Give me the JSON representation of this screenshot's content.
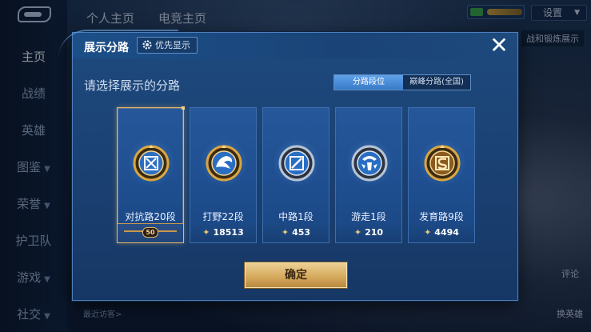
{
  "background": {
    "top_tabs": [
      "个人主页",
      "电竞主页"
    ],
    "settings_label": "设置",
    "right_hint": "战和锻炼展示",
    "left_nav": [
      {
        "label": "主页",
        "active": true
      },
      {
        "label": "战绩",
        "active": false
      },
      {
        "label": "英雄",
        "active": false
      },
      {
        "label": "图鉴",
        "active": false,
        "expandable": true
      },
      {
        "label": "荣誉",
        "active": false,
        "expandable": true
      },
      {
        "label": "护卫队",
        "active": false
      },
      {
        "label": "游戏",
        "active": false,
        "expandable": true
      },
      {
        "label": "社交",
        "active": false,
        "expandable": true
      }
    ],
    "bottom_left_text": "最近访客>",
    "bottom_right_text_1": "评论",
    "bottom_right_text_2": "换英雄"
  },
  "modal": {
    "title": "展示分路",
    "priority_label": "优先显示",
    "close_icon": "close-icon",
    "subtitle": "请选择展示的分路",
    "tabs": [
      {
        "label": "分路段位",
        "active": true
      },
      {
        "label": "巅峰分路(全国)",
        "active": false
      }
    ],
    "cards": [
      {
        "label": "对抗路20段",
        "value": "50",
        "selected": true,
        "emblem": "clash-lane-emblem-icon",
        "emblem_color": "#d9a641"
      },
      {
        "label": "打野22段",
        "value": "18513",
        "selected": false,
        "emblem": "jungle-emblem-icon",
        "emblem_color": "#d9a641"
      },
      {
        "label": "中路1段",
        "value": "453",
        "selected": false,
        "emblem": "mid-lane-emblem-icon",
        "emblem_color": "#b7c4d4"
      },
      {
        "label": "游走1段",
        "value": "210",
        "selected": false,
        "emblem": "roam-emblem-icon",
        "emblem_color": "#b7c4d4"
      },
      {
        "label": "发育路9段",
        "value": "4494",
        "selected": false,
        "emblem": "farm-lane-emblem-icon",
        "emblem_color": "#d9a641"
      }
    ],
    "confirm_label": "确定"
  },
  "colors": {
    "modal_bg": "#1d4677",
    "accent_gold": "#e3b66a",
    "tab_active": "#4a8ad6"
  }
}
